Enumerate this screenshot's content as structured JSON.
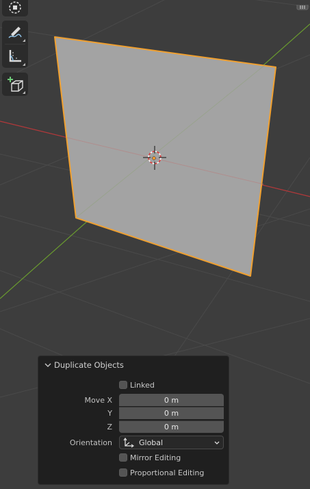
{
  "toolbar": {
    "tools": [
      {
        "icon": "cursor-icon"
      },
      {
        "icon": "annotate-icon"
      },
      {
        "icon": "measure-icon"
      },
      {
        "icon": "add-cube-icon"
      }
    ]
  },
  "colors": {
    "background": "#3d3d3d",
    "x_axis": "#b3383a",
    "y_axis": "#6a9b2f",
    "plane_fill": "#a3a3a3",
    "selection_outline": "#f0a030",
    "panel_bg": "#1f1f1f",
    "field_bg": "#545454"
  },
  "panel": {
    "title": "Duplicate Objects",
    "linked_label": "Linked",
    "linked_checked": false,
    "move_labels": [
      "Move X",
      "Y",
      "Z"
    ],
    "move_values": [
      "0 m",
      "0 m",
      "0 m"
    ],
    "orientation_label": "Orientation",
    "orientation_value": "Global",
    "mirror_label": "Mirror Editing",
    "mirror_checked": false,
    "proportional_label": "Proportional Editing",
    "proportional_checked": false
  }
}
